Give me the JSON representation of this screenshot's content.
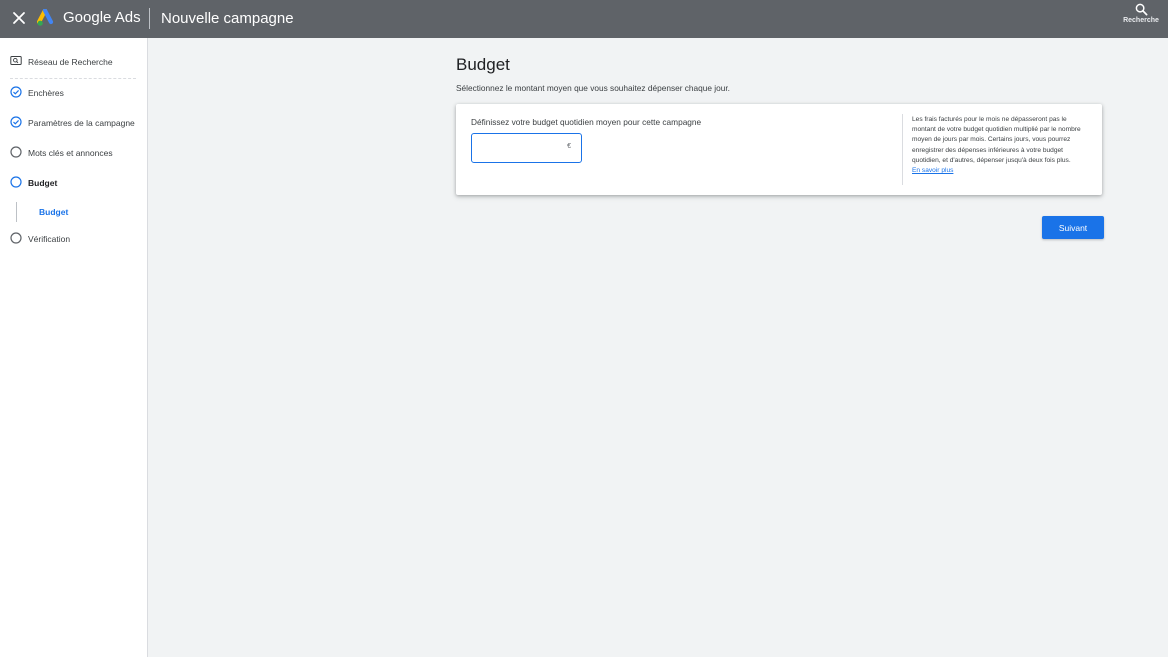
{
  "header": {
    "brand_google": "Google",
    "brand_ads": "Ads",
    "title": "Nouvelle campagne",
    "search_label": "Recherche"
  },
  "sidebar": {
    "items": [
      {
        "label": "Réseau de Recherche",
        "icon": "search-network-icon",
        "state": "done"
      },
      {
        "label": "Enchères",
        "icon": "check-circle-icon",
        "state": "done"
      },
      {
        "label": "Paramètres de la campagne",
        "icon": "check-circle-icon",
        "state": "done"
      },
      {
        "label": "Mots clés et annonces",
        "icon": "empty-circle-icon",
        "state": "todo"
      },
      {
        "label": "Budget",
        "icon": "empty-circle-icon",
        "state": "active"
      },
      {
        "label": "Vérification",
        "icon": "empty-circle-icon",
        "state": "todo"
      }
    ],
    "sub_item": "Budget"
  },
  "main": {
    "title": "Budget",
    "subtitle": "Sélectionnez le montant moyen que vous souhaitez dépenser chaque jour.",
    "card": {
      "input_label": "Définissez votre budget quotidien moyen pour cette campagne",
      "input_value": "",
      "currency": "€",
      "info": "Les frais facturés pour le mois ne dépasseront pas le montant de votre budget quotidien multiplié par le nombre moyen de jours par mois. Certains jours, vous pourrez enregistrer des dépenses inférieures à votre budget quotidien, et d'autres, dépenser jusqu'à deux fois plus.",
      "info_link": "En savoir plus"
    },
    "next_button": "Suivant"
  },
  "colors": {
    "topbar": "#5f6368",
    "accent": "#1a73e8",
    "background": "#f1f3f4"
  }
}
